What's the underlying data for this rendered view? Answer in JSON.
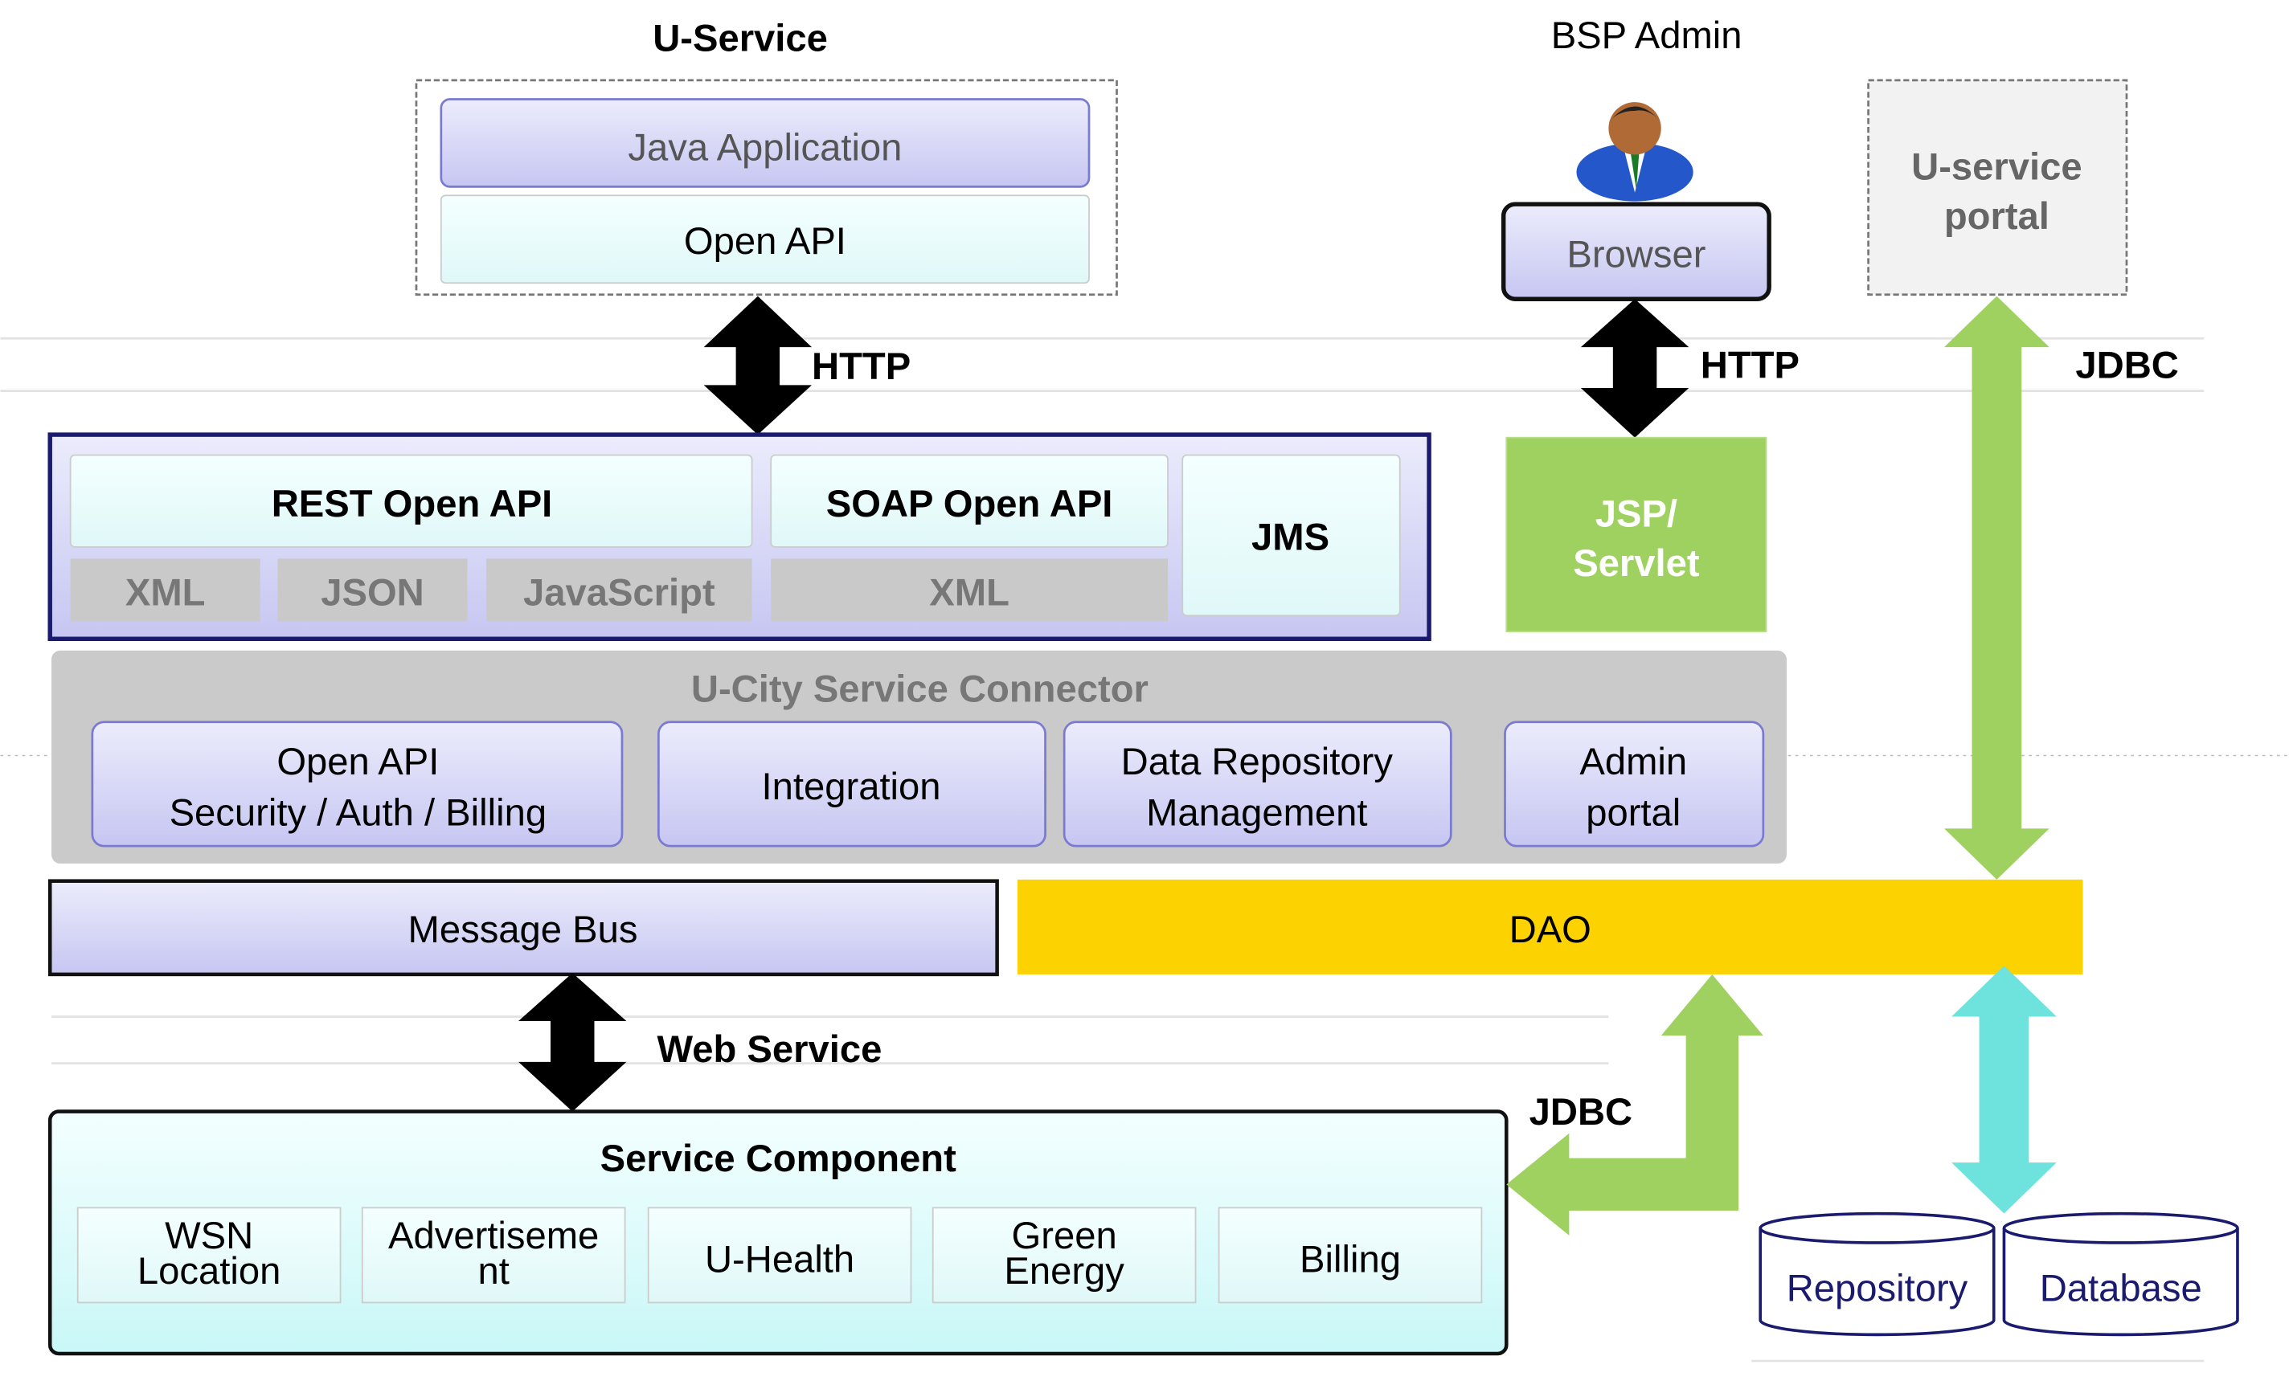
{
  "u_service": {
    "title": "U-Service",
    "java_app": "Java Application",
    "open_api": "Open API"
  },
  "bsp_admin": {
    "title": "BSP Admin",
    "browser": "Browser",
    "icon": "person-icon"
  },
  "u_service_portal": {
    "line1": "U-service",
    "line2": "portal"
  },
  "arrows": {
    "http_left": "HTTP",
    "http_right": "HTTP",
    "jdbc_top": "JDBC",
    "web_service": "Web Service",
    "jdbc_bottom": "JDBC"
  },
  "api_layer": {
    "rest": "REST Open API",
    "soap": "SOAP Open API",
    "jms": "JMS",
    "formats": [
      "XML",
      "JSON",
      "JavaScript",
      "XML"
    ]
  },
  "jsp": {
    "line1": "JSP/",
    "line2": "Servlet"
  },
  "connector": {
    "title": "U-City Service Connector",
    "modules": [
      {
        "line1": "Open API",
        "line2": "Security / Auth / Billing"
      },
      {
        "line1": "Integration"
      },
      {
        "line1": "Data Repository",
        "line2": "Management"
      },
      {
        "line1": "Admin",
        "line2": "portal"
      }
    ]
  },
  "message_bus": "Message Bus",
  "dao": "DAO",
  "service_component": {
    "title": "Service Component",
    "items": [
      {
        "line1": "WSN",
        "line2": "Location"
      },
      {
        "line1": "Advertiseme",
        "line2": "nt"
      },
      {
        "line1": "U-Health"
      },
      {
        "line1": "Green",
        "line2": "Energy"
      },
      {
        "line1": "Billing"
      }
    ]
  },
  "storage": {
    "repository": "Repository",
    "database": "Database"
  },
  "colors": {
    "lavender": "#d6d6f7",
    "cyan_box": "#e6fbfb",
    "green": "#9fd160",
    "dao": "#fcd200",
    "cyan_arrow": "#6ee3dd",
    "navy": "#1a1a6e"
  }
}
